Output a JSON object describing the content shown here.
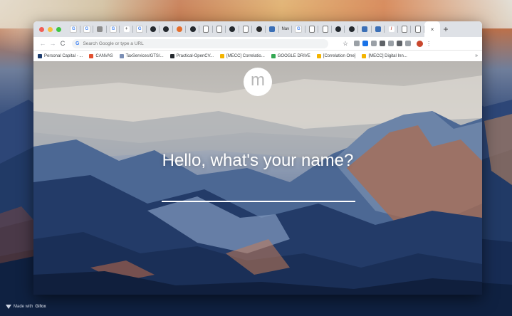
{
  "browser": {
    "tabs": [
      {
        "icon": "g",
        "letter": "G"
      },
      {
        "icon": "g",
        "letter": "G"
      },
      {
        "icon": "grid",
        "letter": ""
      },
      {
        "icon": "g",
        "letter": "G"
      },
      {
        "icon": "plus",
        "letter": "+"
      },
      {
        "icon": "g",
        "letter": "G"
      },
      {
        "icon": "gh",
        "letter": ""
      },
      {
        "icon": "gh",
        "letter": ""
      },
      {
        "icon": "dot",
        "letter": ""
      },
      {
        "icon": "gh",
        "letter": ""
      },
      {
        "icon": "doc",
        "letter": ""
      },
      {
        "icon": "doc",
        "letter": ""
      },
      {
        "icon": "gh",
        "letter": ""
      },
      {
        "icon": "doc",
        "letter": ""
      },
      {
        "icon": "apple",
        "letter": ""
      },
      {
        "icon": "img",
        "letter": ""
      },
      {
        "icon": "nav",
        "letter": "Nav"
      },
      {
        "icon": "g",
        "letter": "G"
      },
      {
        "icon": "doc",
        "letter": ""
      },
      {
        "icon": "doc",
        "letter": ""
      },
      {
        "icon": "gh",
        "letter": ""
      },
      {
        "icon": "gh",
        "letter": ""
      },
      {
        "icon": "img",
        "letter": ""
      },
      {
        "icon": "img",
        "letter": ""
      },
      {
        "icon": "edit",
        "letter": "/"
      },
      {
        "icon": "doc",
        "letter": ""
      },
      {
        "icon": "doc",
        "letter": ""
      }
    ],
    "active_tab_close": "×",
    "new_tab_label": "+",
    "back_label": "←",
    "forward_label": "→",
    "reload_label": "C",
    "omnibox_placeholder": "Search Google or type a URL",
    "omnibox_g": "G",
    "star_label": "☆",
    "menu_label": "⋮",
    "bookmarks": [
      {
        "label": "Personal Capital - ...",
        "color": "#1d3c6e"
      },
      {
        "label": "CANVAS",
        "color": "#e2502f"
      },
      {
        "label": "TaxServices/GTS/...",
        "color": "#7b8fb5"
      },
      {
        "label": "Practical-OpenCV...",
        "color": "#24292e"
      },
      {
        "label": "[MECC] Correlatio...",
        "color": "#f4b400"
      },
      {
        "label": "GOOGLE DRIVE",
        "color": "#34a853"
      },
      {
        "label": "[Correlation One]",
        "color": "#f4b400"
      },
      {
        "label": "[MECC] Digital Inn...",
        "color": "#f4b400"
      }
    ],
    "bookmarks_more": "»",
    "extensions": [
      "#9aa0a6",
      "#1a73e8",
      "#9aa0a6",
      "#5f6368",
      "#9aa0a6",
      "#5f6368",
      "#9aa0a6"
    ]
  },
  "momentum": {
    "logo_letter": "m",
    "greeting": "Hello, what's your name?",
    "name_value": ""
  },
  "footer": {
    "made_with": "Made with",
    "brand": "Gifox"
  }
}
